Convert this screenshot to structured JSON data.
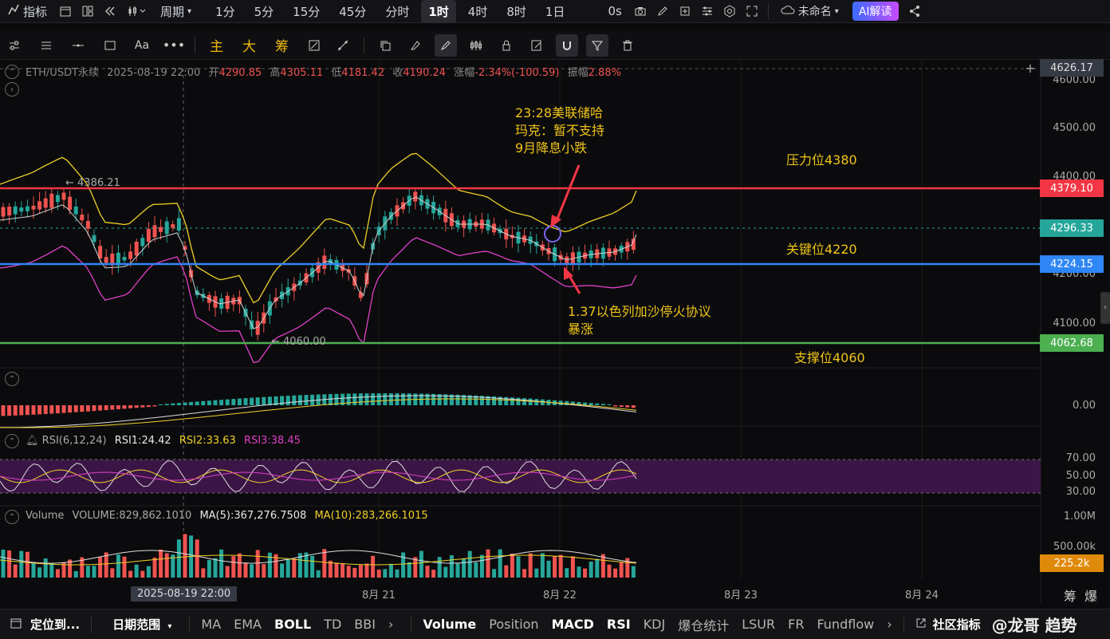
{
  "top_toolbar": {
    "indicators_label": "指标",
    "period_label": "周期",
    "intervals": [
      "1分",
      "5分",
      "15分",
      "45分",
      "分时",
      "1时",
      "4时",
      "8时",
      "1日"
    ],
    "active_interval": "1时",
    "countdown": "0s",
    "layout_name": "未命名",
    "ai_label": "AI解读"
  },
  "draw_toolbar": {
    "chars": [
      "主",
      "大",
      "筹"
    ],
    "font_label": "Aa"
  },
  "info": {
    "symbol": "ETH/USDT永续",
    "datetime": "2025-08-19 22:00",
    "open_label": "开",
    "open": "4290.85",
    "high_label": "高",
    "high": "4305.11",
    "low_label": "低",
    "low": "4181.42",
    "close_label": "收",
    "close": "4190.24",
    "change_label": "涨幅",
    "change": "-2.34%(-100.59)",
    "amp_label": "振幅",
    "amp": "2.88%"
  },
  "price_axis": {
    "ticks": [
      "4600.00",
      "4500.00",
      "4400.00",
      "4200.00",
      "4100.00"
    ],
    "top_tag": "4626.17",
    "resistance_tag": "4379.10",
    "current_tag": "4296.33",
    "key_tag": "4224.15",
    "support_tag": "4062.68",
    "macd_zero": "0.00",
    "rsi_ticks": [
      "70.00",
      "50.00",
      "30.00"
    ],
    "vol_ticks": [
      "1.00M",
      "500.00k"
    ],
    "vol_tag": "225.2k"
  },
  "chart_marks": {
    "high_mark": "4386.21",
    "low_mark": "4060.00"
  },
  "annotations": {
    "fed_news": [
      "23:28美联储哈",
      "玛克：暂不支持",
      "9月降息小跌"
    ],
    "resistance": "压力位4380",
    "key": "关键位4220",
    "israel_news": [
      "1.37以色列加沙停火协议",
      "暴涨"
    ],
    "support": "支撑位4060"
  },
  "rsi": {
    "label": "RSI(6,12,24)",
    "rsi1": "RSI1:24.42",
    "rsi2": "RSI2:33.63",
    "rsi3": "RSI3:38.45"
  },
  "volume": {
    "label": "Volume",
    "value": "VOLUME:829,862.1010",
    "ma5": "MA(5):367,276.7508",
    "ma10": "MA(10):283,266.1015"
  },
  "x_axis": {
    "cursor_label": "2025-08-19 22:00",
    "dates": [
      "8月 21",
      "8月 22",
      "8月 23",
      "8月 24"
    ],
    "corner_labels": [
      "筹",
      "爆"
    ]
  },
  "bottom_bar": {
    "locate": "定位到...",
    "date_range": "日期范围",
    "main_indicators": [
      "MA",
      "EMA",
      "BOLL",
      "TD",
      "BBI"
    ],
    "active_main": "BOLL",
    "sub_indicators": [
      "Volume",
      "Position",
      "MACD",
      "RSI",
      "KDJ",
      "爆仓统计",
      "LSUR",
      "FR",
      "Fundflow"
    ],
    "active_sub": [
      "Volume",
      "MACD",
      "RSI"
    ],
    "community": "社区指标",
    "watermark": "@龙哥 趋势"
  },
  "colors": {
    "up": "#26a69a",
    "down": "#ef5350",
    "resistance_line": "#f23645",
    "key_line": "#2f86f6",
    "support_line": "#4caf50",
    "boll_upper": "#f0d028",
    "boll_mid": "#cfcfcf",
    "boll_lower": "#e040c8",
    "annotation": "#f0c419"
  }
}
